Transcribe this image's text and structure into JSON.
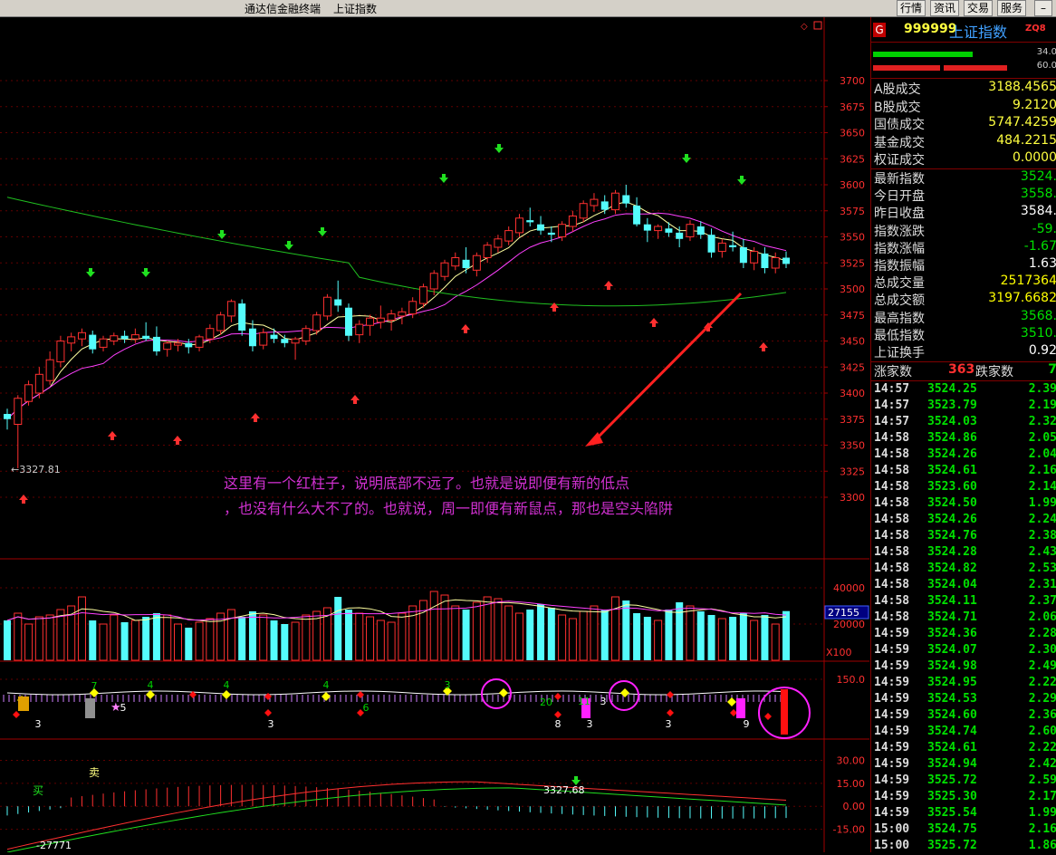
{
  "window": {
    "app_title": "通达信金融终端",
    "symbol_title": "上证指数"
  },
  "toolbar": {
    "buttons": [
      "行情",
      "资讯",
      "交易",
      "服务"
    ]
  },
  "price_axis": {
    "ticks": [
      "3700",
      "3675",
      "3650",
      "3625",
      "3600",
      "3575",
      "3550",
      "3525",
      "3500",
      "3475",
      "3450",
      "3425",
      "3400",
      "3375",
      "3350",
      "3325",
      "3300"
    ]
  },
  "price_chart": {
    "low_marker": "←3327.81"
  },
  "annotation": {
    "line1": "这里有一个红柱子，说明底部不远了。也就是说即便有新的低点",
    "line2": "，也没有什么大不了的。也就说，周一即便有新鼠点，那也是空头陷阱"
  },
  "volume_panel": {
    "ticks": [
      "40000",
      "20000"
    ],
    "current_label": "27155",
    "unit_label": "X100"
  },
  "indicator_panel": {
    "tick": "150.0",
    "digits": [
      {
        "t": "3",
        "c": "#ffffff",
        "r": 0
      },
      {
        "t": "7",
        "c": "#00d000",
        "r": 0
      },
      {
        "t": "5",
        "c": "#ffffff",
        "r": 1
      },
      {
        "t": "4",
        "c": "#00d000",
        "r": 0
      },
      {
        "t": "4",
        "c": "#00d000",
        "r": 0
      },
      {
        "t": "3",
        "c": "#ffffff",
        "r": 1
      },
      {
        "t": "4",
        "c": "#00d000",
        "r": 0
      },
      {
        "t": "6",
        "c": "#00d000",
        "r": 0
      },
      {
        "t": "3",
        "c": "#00d000",
        "r": 0
      },
      {
        "t": "20",
        "c": "#00d000",
        "r": 0
      },
      {
        "t": "11",
        "c": "#00d000",
        "r": 0
      },
      {
        "t": "3",
        "c": "#ffffff",
        "r": 1
      },
      {
        "t": "8",
        "c": "#ffffff",
        "r": 1
      },
      {
        "t": "3",
        "c": "#ffffff",
        "r": 1
      },
      {
        "t": "3",
        "c": "#ffffff",
        "r": 1
      },
      {
        "t": "9",
        "c": "#ffffff",
        "r": 1
      }
    ]
  },
  "macd_panel": {
    "ticks": [
      "30.00",
      "15.00",
      "0.00",
      "-15.00"
    ],
    "sell_label": "卖",
    "buy_label": "买",
    "low_value": "-27771",
    "mid_value": "3327.68"
  },
  "side_panel": {
    "code": "999999",
    "name": "上证指数",
    "badge": "G",
    "tag": "ZQ8",
    "bar_values": [
      "34.0",
      "60.0"
    ],
    "stats_top": [
      {
        "label": "A股成交",
        "value": "3188.4565"
      },
      {
        "label": "B股成交",
        "value": "9.2120"
      },
      {
        "label": "国债成交",
        "value": "5747.4259"
      },
      {
        "label": "基金成交",
        "value": "484.2215"
      },
      {
        "label": "权证成交",
        "value": "0.0000"
      }
    ],
    "stats_main": [
      {
        "label": "最新指数",
        "value": "3524.",
        "color": "#00e000"
      },
      {
        "label": "今日开盘",
        "value": "3558.",
        "color": "#00e000"
      },
      {
        "label": "昨日收盘",
        "value": "3584.",
        "color": "#ffffff"
      },
      {
        "label": "指数涨跌",
        "value": "-59.",
        "color": "#00e000"
      },
      {
        "label": "指数涨幅",
        "value": "-1.67",
        "color": "#00e000"
      },
      {
        "label": "指数振幅",
        "value": "1.63",
        "color": "#ffffff"
      },
      {
        "label": "总成交量",
        "value": "2517364",
        "color": "#ffff00"
      },
      {
        "label": "总成交额",
        "value": "3197.6682",
        "color": "#ffff00"
      },
      {
        "label": "最高指数",
        "value": "3568.",
        "color": "#00e000"
      },
      {
        "label": "最低指数",
        "value": "3510.",
        "color": "#00e000"
      },
      {
        "label": "上证换手",
        "value": "0.92",
        "color": "#ffffff"
      }
    ],
    "breadth": {
      "up_label": "涨家数",
      "up_value": "363",
      "down_label": "跌家数",
      "down_value": "7"
    },
    "ticks": [
      [
        "14:57",
        "3524.25",
        "2.39"
      ],
      [
        "14:57",
        "3523.79",
        "2.19"
      ],
      [
        "14:57",
        "3524.03",
        "2.32"
      ],
      [
        "14:58",
        "3524.86",
        "2.05"
      ],
      [
        "14:58",
        "3524.26",
        "2.04"
      ],
      [
        "14:58",
        "3524.61",
        "2.16"
      ],
      [
        "14:58",
        "3523.60",
        "2.14"
      ],
      [
        "14:58",
        "3524.50",
        "1.99"
      ],
      [
        "14:58",
        "3524.26",
        "2.24"
      ],
      [
        "14:58",
        "3524.76",
        "2.38"
      ],
      [
        "14:58",
        "3524.28",
        "2.43"
      ],
      [
        "14:58",
        "3524.82",
        "2.53"
      ],
      [
        "14:58",
        "3524.04",
        "2.31"
      ],
      [
        "14:58",
        "3524.11",
        "2.37"
      ],
      [
        "14:58",
        "3524.71",
        "2.06"
      ],
      [
        "14:59",
        "3524.36",
        "2.28"
      ],
      [
        "14:59",
        "3524.07",
        "2.30"
      ],
      [
        "14:59",
        "3524.98",
        "2.49"
      ],
      [
        "14:59",
        "3524.95",
        "2.22"
      ],
      [
        "14:59",
        "3524.53",
        "2.29"
      ],
      [
        "14:59",
        "3524.60",
        "2.36"
      ],
      [
        "14:59",
        "3524.74",
        "2.60"
      ],
      [
        "14:59",
        "3524.61",
        "2.22"
      ],
      [
        "14:59",
        "3524.94",
        "2.42"
      ],
      [
        "14:59",
        "3525.72",
        "2.59"
      ],
      [
        "14:59",
        "3525.30",
        "2.17"
      ],
      [
        "14:59",
        "3525.54",
        "1.99"
      ],
      [
        "15:00",
        "3524.75",
        "2.16"
      ],
      [
        "15:00",
        "3525.72",
        "1.86"
      ]
    ]
  },
  "chart_data": {
    "type": "candlestick",
    "ylim": [
      3290,
      3710
    ],
    "ohlc": [
      [
        3380,
        3385,
        3365,
        3375
      ],
      [
        3370,
        3398,
        3327.81,
        3395
      ],
      [
        3392,
        3412,
        3388,
        3408
      ],
      [
        3400,
        3425,
        3395,
        3418
      ],
      [
        3412,
        3440,
        3408,
        3432
      ],
      [
        3430,
        3455,
        3425,
        3450
      ],
      [
        3448,
        3458,
        3440,
        3454
      ],
      [
        3452,
        3462,
        3445,
        3458
      ],
      [
        3456,
        3460,
        3438,
        3442
      ],
      [
        3444,
        3455,
        3440,
        3452
      ],
      [
        3450,
        3458,
        3446,
        3455
      ],
      [
        3455,
        3460,
        3448,
        3452
      ],
      [
        3452,
        3462,
        3448,
        3456
      ],
      [
        3455,
        3468,
        3450,
        3452
      ],
      [
        3454,
        3464,
        3436,
        3440
      ],
      [
        3442,
        3450,
        3435,
        3448
      ],
      [
        3446,
        3452,
        3440,
        3448
      ],
      [
        3448,
        3452,
        3438,
        3444
      ],
      [
        3444,
        3456,
        3440,
        3454
      ],
      [
        3452,
        3466,
        3448,
        3462
      ],
      [
        3460,
        3478,
        3456,
        3475
      ],
      [
        3474,
        3490,
        3468,
        3488
      ],
      [
        3486,
        3490,
        3455,
        3460
      ],
      [
        3462,
        3470,
        3440,
        3445
      ],
      [
        3446,
        3462,
        3442,
        3458
      ],
      [
        3456,
        3462,
        3448,
        3452
      ],
      [
        3452,
        3456,
        3444,
        3448
      ],
      [
        3448,
        3454,
        3432,
        3452
      ],
      [
        3450,
        3465,
        3446,
        3462
      ],
      [
        3460,
        3478,
        3456,
        3475
      ],
      [
        3474,
        3495,
        3470,
        3492
      ],
      [
        3490,
        3508,
        3478,
        3484
      ],
      [
        3482,
        3486,
        3450,
        3455
      ],
      [
        3456,
        3470,
        3448,
        3466
      ],
      [
        3465,
        3475,
        3455,
        3472
      ],
      [
        3468,
        3484,
        3462,
        3472
      ],
      [
        3470,
        3480,
        3460,
        3476
      ],
      [
        3474,
        3482,
        3466,
        3478
      ],
      [
        3476,
        3492,
        3472,
        3488
      ],
      [
        3486,
        3505,
        3482,
        3502
      ],
      [
        3500,
        3518,
        3494,
        3515
      ],
      [
        3512,
        3528,
        3508,
        3525
      ],
      [
        3522,
        3535,
        3518,
        3530
      ],
      [
        3528,
        3540,
        3515,
        3520
      ],
      [
        3518,
        3535,
        3512,
        3532
      ],
      [
        3530,
        3545,
        3525,
        3542
      ],
      [
        3540,
        3552,
        3535,
        3548
      ],
      [
        3546,
        3560,
        3542,
        3556
      ],
      [
        3554,
        3572,
        3550,
        3568
      ],
      [
        3566,
        3578,
        3560,
        3564
      ],
      [
        3562,
        3570,
        3552,
        3556
      ],
      [
        3554,
        3560,
        3545,
        3552
      ],
      [
        3550,
        3565,
        3546,
        3562
      ],
      [
        3560,
        3575,
        3555,
        3570
      ],
      [
        3568,
        3585,
        3564,
        3582
      ],
      [
        3580,
        3592,
        3574,
        3586
      ],
      [
        3584,
        3590,
        3572,
        3576
      ],
      [
        3576,
        3595,
        3572,
        3592
      ],
      [
        3590,
        3600,
        3578,
        3582
      ],
      [
        3580,
        3588,
        3560,
        3562
      ],
      [
        3562,
        3568,
        3545,
        3556
      ],
      [
        3556,
        3562,
        3548,
        3560
      ],
      [
        3558,
        3564,
        3550,
        3554
      ],
      [
        3554,
        3560,
        3540,
        3548
      ],
      [
        3550,
        3566,
        3546,
        3562
      ],
      [
        3560,
        3565,
        3548,
        3552
      ],
      [
        3552,
        3558,
        3530,
        3535
      ],
      [
        3536,
        3548,
        3530,
        3544
      ],
      [
        3542,
        3555,
        3536,
        3540
      ],
      [
        3540,
        3548,
        3520,
        3525
      ],
      [
        3525,
        3540,
        3518,
        3536
      ],
      [
        3534,
        3540,
        3515,
        3520
      ],
      [
        3520,
        3535,
        3515,
        3530
      ],
      [
        3530,
        3536,
        3520,
        3524
      ]
    ],
    "volume": [
      22000,
      26000,
      20000,
      24000,
      25000,
      28000,
      30000,
      35000,
      22000,
      20000,
      25000,
      21000,
      22000,
      24000,
      26000,
      25000,
      20000,
      18000,
      21000,
      23000,
      26000,
      28000,
      24000,
      27000,
      25000,
      22000,
      20000,
      21000,
      25000,
      27000,
      29000,
      35000,
      28000,
      26000,
      24000,
      22000,
      21000,
      26000,
      30000,
      33000,
      38000,
      36000,
      30000,
      28000,
      32000,
      35000,
      34000,
      30000,
      26000,
      28000,
      31000,
      29000,
      25000,
      23000,
      27000,
      30000,
      28000,
      35000,
      33000,
      26000,
      24000,
      22000,
      28000,
      32000,
      30000,
      27000,
      25000,
      23000,
      24000,
      26000,
      22000,
      25000,
      20000,
      27155
    ],
    "volume_ylim": [
      0,
      45000
    ],
    "macd_ylim": [
      -30,
      35
    ]
  }
}
